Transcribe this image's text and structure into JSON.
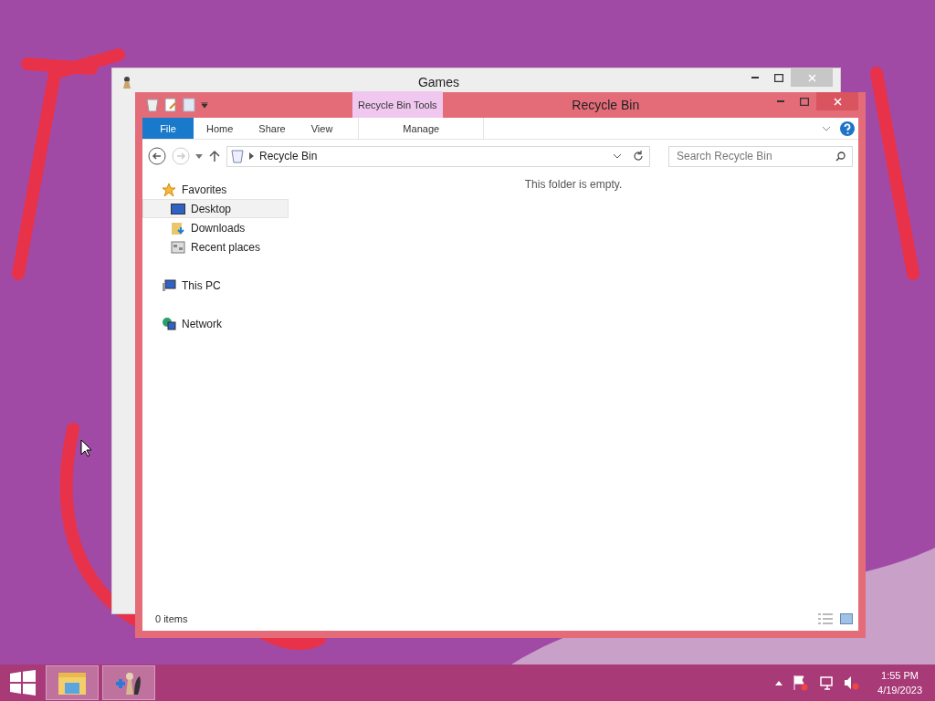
{
  "background_window": {
    "title": "Games"
  },
  "window": {
    "title": "Recycle Bin",
    "context_group": "Recycle Bin Tools"
  },
  "ribbon_tabs": [
    {
      "label": "File",
      "kind": "file",
      "selected": false
    },
    {
      "label": "Home",
      "kind": "tab",
      "selected": false
    },
    {
      "label": "Share",
      "kind": "tab",
      "selected": false
    },
    {
      "label": "View",
      "kind": "tab",
      "selected": false
    },
    {
      "label": "Manage",
      "kind": "context",
      "selected": false
    }
  ],
  "address": {
    "path": "Recycle Bin"
  },
  "search": {
    "placeholder": "Search Recycle Bin"
  },
  "navigation": [
    {
      "label": "Favorites",
      "kind": "star",
      "selected": false,
      "children": [
        {
          "label": "Desktop",
          "kind": "desktop",
          "selected": true
        },
        {
          "label": "Downloads",
          "kind": "downloads",
          "selected": false
        },
        {
          "label": "Recent places",
          "kind": "recent",
          "selected": false
        }
      ]
    },
    {
      "label": "This PC",
      "kind": "pc",
      "selected": false
    },
    {
      "label": "Network",
      "kind": "network",
      "selected": false
    }
  ],
  "content": {
    "empty_message": "This folder is empty."
  },
  "status_bar": {
    "item_count": "0 items"
  },
  "taskbar": {
    "apps": [
      {
        "kind": "explorer"
      },
      {
        "kind": "games"
      }
    ],
    "clock": {
      "time": "1:55 PM",
      "date": "4/19/2023"
    }
  }
}
